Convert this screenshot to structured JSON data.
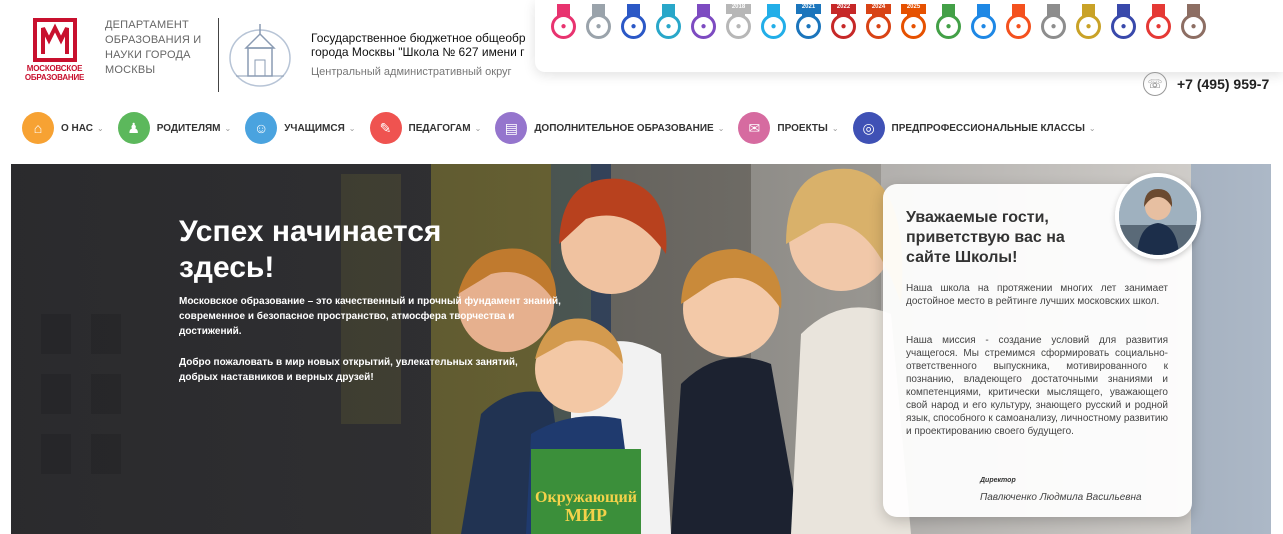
{
  "department": {
    "logo_text": "МОСКОВСКОЕ ОБРАЗОВАНИЕ",
    "name": "ДЕПАРТАМЕНТ ОБРАЗОВАНИЯ И НАУКИ ГОРОДА МОСКВЫ"
  },
  "school": {
    "title_line1": "Государственное бюджетное общеобр",
    "title_line2": "города Москвы \"Школа № 627 имени г",
    "okrug": "Центральный административный округ"
  },
  "badges": [
    {
      "icon": "nose-badge-icon",
      "color": "#e8336f",
      "year": ""
    },
    {
      "icon": "book-badge-icon",
      "color": "#9aa3ab",
      "year": ""
    },
    {
      "icon": "mask-badge-icon",
      "color": "#2b58c6",
      "year": ""
    },
    {
      "icon": "heart-badge-icon",
      "color": "#29a7c9",
      "year": ""
    },
    {
      "icon": "coin-badge-icon",
      "color": "#7d4bc1",
      "year": ""
    },
    {
      "icon": "2018-badge-icon",
      "color": "#b7b7b7",
      "year": "2018"
    },
    {
      "icon": "tech-badge-icon",
      "color": "#22aee8",
      "year": ""
    },
    {
      "icon": "2021-badge-icon",
      "color": "#1b75bc",
      "year": "2021"
    },
    {
      "icon": "heart-2022-badge-icon",
      "color": "#c62828",
      "year": "2022"
    },
    {
      "icon": "key-2024-badge-icon",
      "color": "#d84315",
      "year": "2024"
    },
    {
      "icon": "plant-2025-badge-icon",
      "color": "#e65100",
      "year": "2025"
    },
    {
      "icon": "eco-badge-icon",
      "color": "#43a047",
      "year": ""
    },
    {
      "icon": "books-badge-icon",
      "color": "#1e88e5",
      "year": ""
    },
    {
      "icon": "sigma-badge-icon",
      "color": "#f4511e",
      "year": ""
    },
    {
      "icon": "laurel-badge-icon",
      "color": "#8d8d8d",
      "year": ""
    },
    {
      "icon": "gold-badge-icon",
      "color": "#c9a227",
      "year": ""
    },
    {
      "icon": "mesh-badge-icon",
      "color": "#3949ab",
      "year": ""
    },
    {
      "icon": "flower-badge-icon",
      "color": "#e53935",
      "year": ""
    },
    {
      "icon": "owl-badge-icon",
      "color": "#8d6e63",
      "year": ""
    }
  ],
  "phone": {
    "number": "+7 (495) 959-7"
  },
  "nav": [
    {
      "label": "О НАС",
      "color": "#f7a233",
      "icon": "home-icon",
      "glyph": "⌂"
    },
    {
      "label": "РОДИТЕЛЯМ",
      "color": "#5cb85c",
      "icon": "family-icon",
      "glyph": "♟"
    },
    {
      "label": "УЧАЩИМСЯ",
      "color": "#4aa3df",
      "icon": "student-icon",
      "glyph": "☺"
    },
    {
      "label": "ПЕДАГОГАМ",
      "color": "#ef5350",
      "icon": "teacher-icon",
      "glyph": "✎"
    },
    {
      "label": "ДОПОЛНИТЕЛЬНОЕ ОБРАЗОВАНИЕ",
      "color": "#9575cd",
      "icon": "book-icon",
      "glyph": "▤"
    },
    {
      "label": "ПРОЕКТЫ",
      "color": "#d66ba0",
      "icon": "projects-icon",
      "glyph": "✉"
    },
    {
      "label": "ПРЕДПРОФЕССИОНАЛЬНЫЕ КЛАССЫ",
      "color": "#3f51b5",
      "icon": "globe-icon",
      "glyph": "◎"
    }
  ],
  "hero": {
    "title": "Успех начинается здесь!",
    "paragraph1": "Московское образование – это качественный и прочный фундамент знаний, современное и безопасное пространство, атмосфера творчества и достижений.",
    "paragraph2": "Добро пожаловать в мир новых открытий, увлекательных занятий, добрых наставников и верных друзей!",
    "book_line1": "Окружающий",
    "book_line2": "МИР"
  },
  "welcome": {
    "title": "Уважаемые гости, приветствую вас на сайте Школы!",
    "p1": "Наша школа на протяжении многих лет занимает достойное место в рейтинге лучших московских школ.",
    "p2": "Наша миссия - создание условий для развития учащегося. Мы стремимся сформировать социально-ответственного выпускника, мотивированного к познанию, владеющего достаточными знаниями и компетенциями, критически мыслящего, уважающего свой народ и его культуру, знающего русский и родной язык, способного к самоанализу, личностному развитию и проектированию своего будущего.",
    "role": "Директор",
    "name": "Павлюченко Людмила Васильевна"
  }
}
